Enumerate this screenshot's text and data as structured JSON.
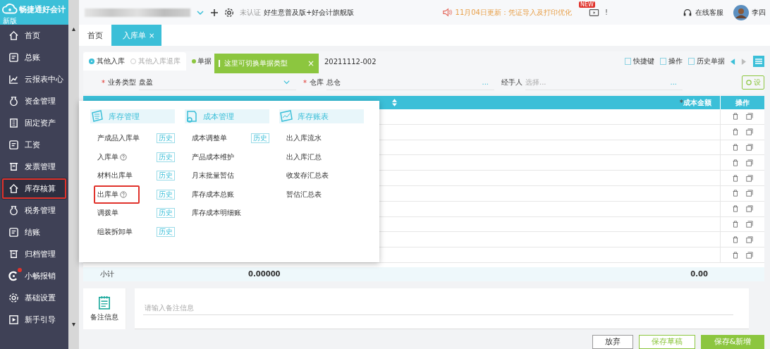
{
  "app": {
    "logo": "畅捷通好会计",
    "edition_badge": "新版"
  },
  "sidebar": {
    "scroll_up": "▴",
    "scroll_down": "▾",
    "items": [
      {
        "label": "首页",
        "selected": false,
        "highlighted": false,
        "badge_dot": false
      },
      {
        "label": "总账",
        "selected": false,
        "highlighted": false,
        "badge_dot": false
      },
      {
        "label": "云报表中心",
        "selected": false,
        "highlighted": false,
        "badge_dot": false
      },
      {
        "label": "资金管理",
        "selected": false,
        "highlighted": false,
        "badge_dot": false
      },
      {
        "label": "固定资产",
        "selected": false,
        "highlighted": false,
        "badge_dot": false
      },
      {
        "label": "工资",
        "selected": false,
        "highlighted": false,
        "badge_dot": false
      },
      {
        "label": "发票管理",
        "selected": false,
        "highlighted": false,
        "badge_dot": false
      },
      {
        "label": "库存核算",
        "selected": true,
        "highlighted": true,
        "badge_dot": false
      },
      {
        "label": "税务管理",
        "selected": false,
        "highlighted": false,
        "badge_dot": false
      },
      {
        "label": "结账",
        "selected": false,
        "highlighted": false,
        "badge_dot": false
      },
      {
        "label": "归档管理",
        "selected": false,
        "highlighted": false,
        "badge_dot": false
      },
      {
        "label": "小畅报销",
        "selected": false,
        "highlighted": false,
        "badge_dot": true
      },
      {
        "label": "基础设置",
        "selected": false,
        "highlighted": false,
        "badge_dot": false
      },
      {
        "label": "新手引导",
        "selected": false,
        "highlighted": false,
        "badge_dot": false
      }
    ]
  },
  "topbar": {
    "cert": "未认证",
    "product": "好生意普及版+好会计旗舰版",
    "notice": "11月04日更新：凭证导入及打印优化",
    "new_badge": "NEW",
    "alert": "!",
    "support": "在线客服",
    "user": "李四"
  },
  "tabs": [
    {
      "label": "首页",
      "selected": false,
      "closable": false
    },
    {
      "label": "入库单",
      "selected": true,
      "closable": true
    }
  ],
  "tab_close": "×",
  "form": {
    "types": [
      {
        "label": "其他入库",
        "selected": true
      },
      {
        "label": "其他入库退库",
        "selected": false
      }
    ],
    "date_label": "单据",
    "doc_no": "20211112-002",
    "tooltip": {
      "text": "这里可切换单据类型",
      "close": "×"
    },
    "toolbar": [
      "快捷键",
      "操作",
      "历史单据"
    ],
    "fields": [
      {
        "required_mark": "*",
        "label": "业务类型",
        "value": "盘盈"
      },
      {
        "required_mark": "*",
        "label": "仓库",
        "value": "总仓",
        "lookup": "..."
      },
      {
        "label": "经手人",
        "placeholder": "选择...",
        "lookup": "..."
      }
    ],
    "settings_button": "设"
  },
  "table": {
    "columns": [
      {
        "required_mark": "*",
        "label": "成本金额"
      },
      {
        "label": "操作"
      }
    ],
    "subtotal": {
      "label": "小计",
      "quantity": "0.00000",
      "amount": "0.00"
    }
  },
  "menu": {
    "sections": [
      {
        "title": "库存管理",
        "items": [
          {
            "label": "产成品入库单",
            "help": false,
            "history": "历史",
            "highlighted": false
          },
          {
            "label": "入库单",
            "help": true,
            "history": "历史",
            "highlighted": false
          },
          {
            "label": "材料出库单",
            "help": false,
            "history": "历史",
            "highlighted": false
          },
          {
            "label": "出库单",
            "help": true,
            "history": "历史",
            "highlighted": true
          },
          {
            "label": "调拨单",
            "help": false,
            "history": "历史",
            "highlighted": false
          },
          {
            "label": "组装拆卸单",
            "help": false,
            "history": "历史",
            "highlighted": false
          }
        ]
      },
      {
        "title": "成本管理",
        "items": [
          {
            "label": "成本调整单",
            "help": false,
            "history": "历史",
            "highlighted": false
          },
          {
            "label": "产品成本维护",
            "help": false,
            "highlighted": false
          },
          {
            "label": "月末批量暂估",
            "help": false,
            "highlighted": false
          },
          {
            "label": "库存成本总账",
            "help": false,
            "highlighted": false
          },
          {
            "label": "库存成本明细账",
            "help": false,
            "highlighted": false
          }
        ]
      },
      {
        "title": "库存账表",
        "items": [
          {
            "label": "出入库流水",
            "help": false,
            "highlighted": false
          },
          {
            "label": "出入库汇总",
            "help": false,
            "highlighted": false
          },
          {
            "label": "收发存汇总表",
            "help": false,
            "highlighted": false
          },
          {
            "label": "暂估汇总表",
            "help": false,
            "highlighted": false
          }
        ]
      }
    ]
  },
  "remarks": {
    "label": "备注信息",
    "placeholder": "请输入备注信息"
  },
  "actions": [
    {
      "label": "放弃",
      "kind": "plain"
    },
    {
      "label": "保存草稿",
      "kind": "outline"
    },
    {
      "label": "保存&新增",
      "kind": "primary"
    }
  ]
}
